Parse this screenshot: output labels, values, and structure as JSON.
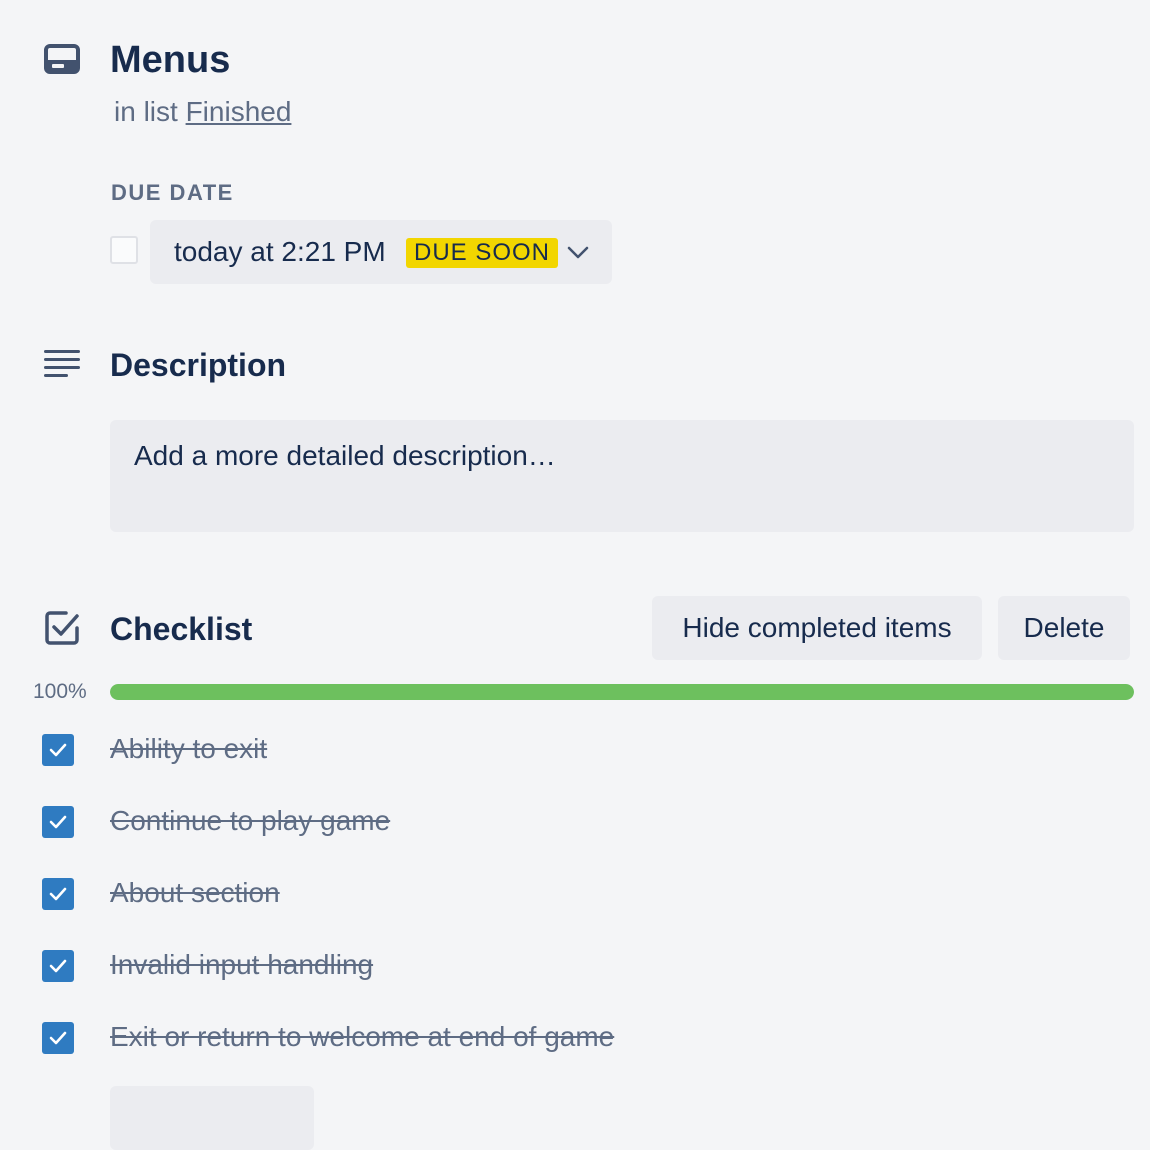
{
  "card": {
    "title": "Menus",
    "in_list_prefix": "in list",
    "list_name": "Finished"
  },
  "due_date": {
    "label": "DUE DATE",
    "value": "today at 2:21 PM",
    "badge": "DUE SOON",
    "completed": false
  },
  "description": {
    "title": "Description",
    "placeholder": "Add a more detailed description…"
  },
  "checklist": {
    "title": "Checklist",
    "hide_completed_label": "Hide completed items",
    "delete_label": "Delete",
    "progress_percent": 100,
    "progress_label": "100%",
    "items": [
      {
        "label": "Ability to exit",
        "checked": true
      },
      {
        "label": "Continue to play game",
        "checked": true
      },
      {
        "label": "About section",
        "checked": true
      },
      {
        "label": "Invalid input handling",
        "checked": true
      },
      {
        "label": "Exit or return to welcome at end of game",
        "checked": true
      }
    ]
  },
  "colors": {
    "progress_fill": "#61bd4f",
    "checkbox_checked": "#2f7bc1",
    "due_soon_badge": "#f2d600"
  },
  "icons": {
    "card": "card-icon",
    "description": "description-lines-icon",
    "checklist": "checklist-icon",
    "dropdown": "chevron-down-icon",
    "check": "checkmark-icon"
  }
}
